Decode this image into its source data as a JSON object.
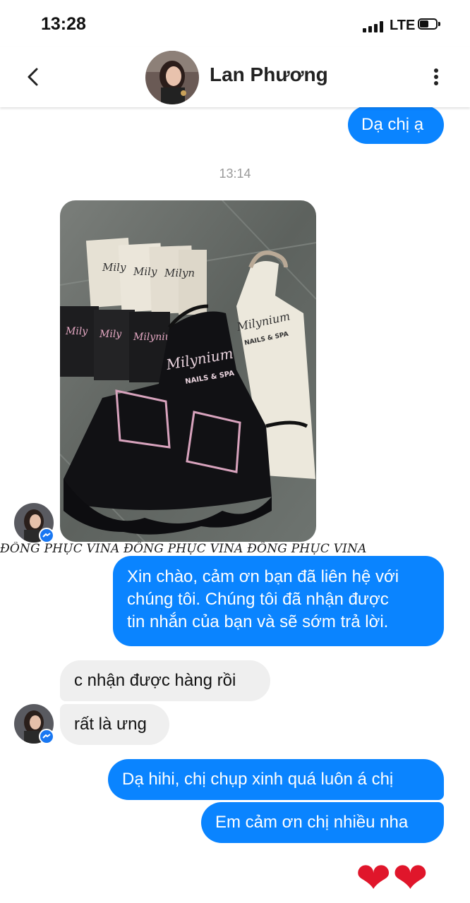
{
  "status": {
    "time": "13:28",
    "network": "LTE"
  },
  "header": {
    "contact_name": "Lan Phương"
  },
  "messages": {
    "m1": "Dạ chị ạ",
    "timestamp": "13:14",
    "m2_line1": "Xin chào, cảm ơn bạn đã liên hệ với",
    "m2_line2": "chúng tôi. Chúng tôi đã nhận được",
    "m2_line3": "tin nhắn của bạn và sẽ sớm trả lời.",
    "m3": "c nhận được hàng rồi",
    "m4": "rất là ưng",
    "m5": "Dạ hihi, chị chụp xinh quá luôn á chị",
    "m6": "Em cảm ơn chị nhiều nha",
    "hearts": "❤❤"
  },
  "photo": {
    "labels": [
      "Milynium",
      "NAILS & SPA"
    ]
  },
  "watermark": "ĐỒNG PHỤC VINA ĐỒNG PHỤC VINA ĐỒNG PHỤC VINA",
  "icons": [
    "back-icon",
    "more-vertical-icon",
    "messenger-badge-icon",
    "signal-icon",
    "battery-icon",
    "heart-icon"
  ],
  "colors": {
    "outgoing_bubble": "#0a84ff",
    "incoming_bubble": "#efefef",
    "heart": "#e0162b"
  }
}
